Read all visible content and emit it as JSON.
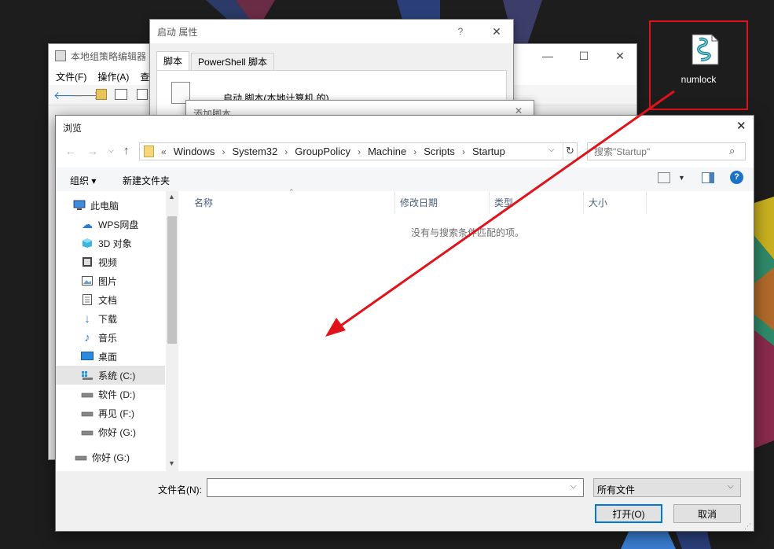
{
  "desktop": {
    "icon_label": "numlock"
  },
  "gpedit_window": {
    "title": "本地组策略编辑器",
    "menu": [
      "文件(F)",
      "操作(A)",
      "查"
    ]
  },
  "startup_props": {
    "title": "启动 属性",
    "help": "?",
    "tabs": [
      "脚本",
      "PowerShell 脚本"
    ],
    "script_heading": "启动 脚本(本地计算机 的)"
  },
  "add_script": {
    "title": "添加脚本"
  },
  "browse": {
    "title": "浏览",
    "address": {
      "overflow": "«",
      "crumbs": [
        "Windows",
        "System32",
        "GroupPolicy",
        "Machine",
        "Scripts",
        "Startup"
      ]
    },
    "search_placeholder": "搜索\"Startup\"",
    "toolbar": {
      "organize": "组织 ▾",
      "new_folder": "新建文件夹"
    },
    "nav": [
      {
        "label": "此电脑",
        "icon": "computer-icon"
      },
      {
        "label": "WPS网盘",
        "icon": "cloud-icon"
      },
      {
        "label": "3D 对象",
        "icon": "cube-icon"
      },
      {
        "label": "视频",
        "icon": "video-icon"
      },
      {
        "label": "图片",
        "icon": "picture-icon"
      },
      {
        "label": "文档",
        "icon": "document-icon"
      },
      {
        "label": "下载",
        "icon": "download-icon"
      },
      {
        "label": "音乐",
        "icon": "music-icon"
      },
      {
        "label": "桌面",
        "icon": "desktop-icon"
      },
      {
        "label": "系统 (C:)",
        "icon": "drive-icon"
      },
      {
        "label": "软件 (D:)",
        "icon": "drive-icon"
      },
      {
        "label": "再见 (F:)",
        "icon": "drive-icon"
      },
      {
        "label": "你好 (G:)",
        "icon": "drive-icon"
      },
      {
        "label": "你好 (G:)",
        "icon": "drive-icon"
      }
    ],
    "columns": [
      "名称",
      "修改日期",
      "类型",
      "大小"
    ],
    "empty_message": "没有与搜索条件匹配的项。",
    "filename_label": "文件名(N):",
    "filename_value": "",
    "filter_value": "所有文件",
    "open_button": "打开(O)",
    "cancel_button": "取消"
  },
  "colors": {
    "annotation_red": "#e0121a",
    "selected_nav": "#e5e5e5",
    "accent_blue": "#0078d7"
  }
}
